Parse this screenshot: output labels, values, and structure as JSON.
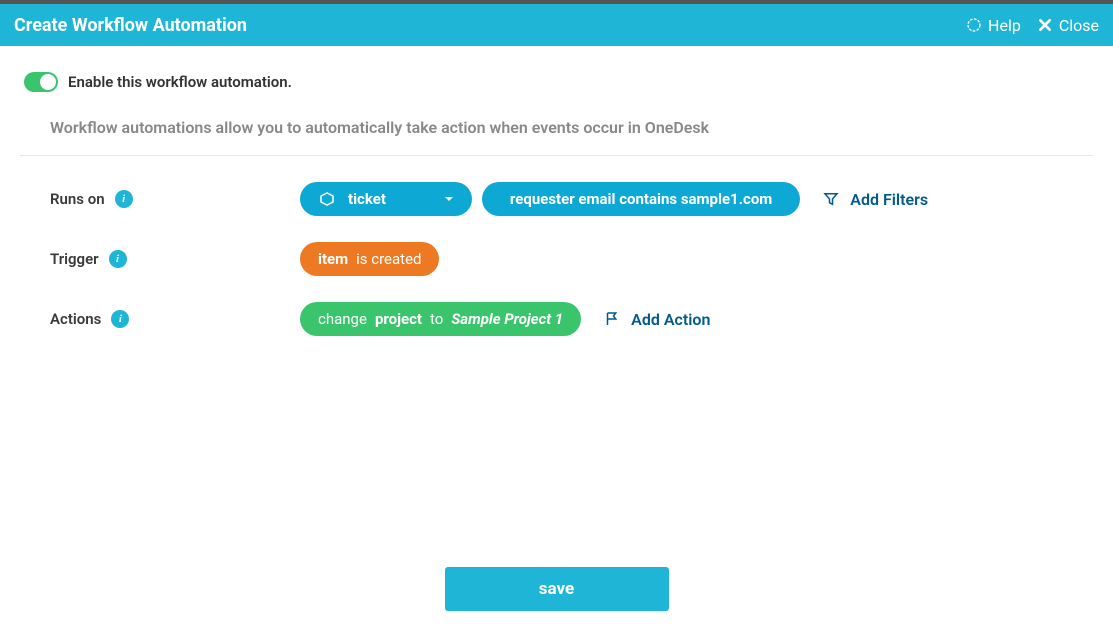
{
  "header": {
    "title": "Create Workflow Automation",
    "help": "Help",
    "close": "Close"
  },
  "enable": {
    "label": "Enable this workflow automation."
  },
  "description": "Workflow automations allow you to automatically take action when events occur in OneDesk",
  "rows": {
    "runsOn": {
      "label": "Runs on",
      "type": "ticket",
      "filter": "requester email contains sample1.com",
      "addFilters": "Add Filters"
    },
    "trigger": {
      "label": "Trigger",
      "item": "item",
      "condition": "is created"
    },
    "actions": {
      "label": "Actions",
      "change": "change",
      "field": "project",
      "to": "to",
      "value": "Sample Project 1",
      "addAction": "Add Action"
    }
  },
  "footer": {
    "save": "save"
  }
}
